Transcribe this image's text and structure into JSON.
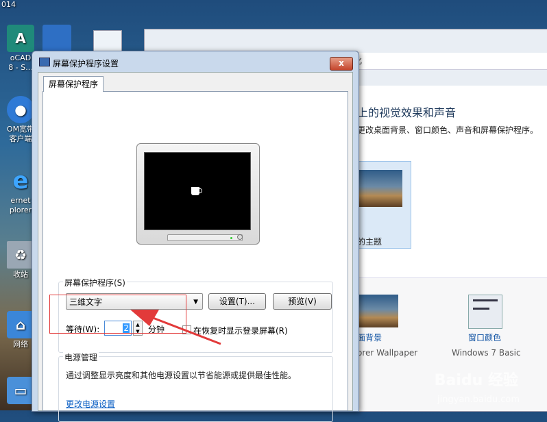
{
  "desktop": {
    "year": "014",
    "icons": [
      {
        "label": "oCAD\n8 - S..."
      },
      {
        "label": "OM宽带\n客户端"
      },
      {
        "label": "ernet\nplorer"
      },
      {
        "label": "收站"
      },
      {
        "label": "网络"
      }
    ]
  },
  "bg_window": {
    "address_fragment": "化",
    "heading": "上的视觉效果和声音",
    "subtitle": "更改桌面背景、窗口颜色、声音和屏幕保护程序。",
    "theme_label": "的主题",
    "desktop_bg_link": "面背景",
    "desktop_bg_sub": "orer Wallpaper",
    "window_color_link": "窗口颜色",
    "window_color_sub": "Windows 7 Basic"
  },
  "dialog": {
    "title": "屏幕保护程序设置",
    "close_label": "x",
    "tab_label": "屏幕保护程序",
    "saver_group_label": "屏幕保护程序(S)",
    "saver_selected": "三维文字",
    "settings_button": "设置(T)...",
    "preview_button": "预览(V)",
    "wait_label": "等待(W):",
    "wait_value": "2",
    "minutes_label": "分钟",
    "resume_checkbox_label": "在恢复时显示登录屏幕(R)",
    "resume_checked": false,
    "power_group_label": "电源管理",
    "power_desc": "通过调整显示亮度和其他电源设置以节省能源或提供最佳性能。",
    "power_link": "更改电源设置"
  },
  "colors": {
    "annotation_red": "#e23a3a",
    "link_blue": "#0b5fc4"
  },
  "watermark": {
    "brand": "Baidu 经验",
    "url": "jingyan.baidu.com"
  }
}
